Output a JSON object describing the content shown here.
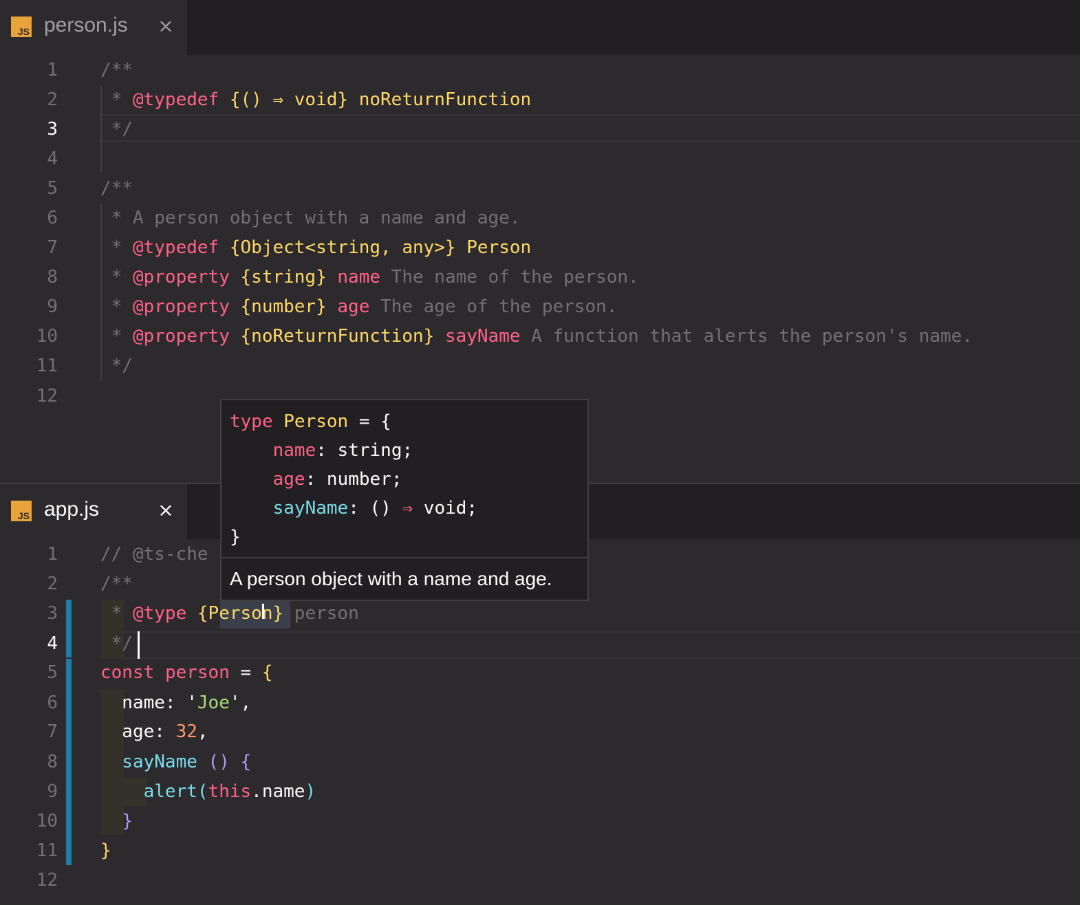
{
  "colors": {
    "background": "#2d2a2e",
    "tabbar": "#221f22",
    "comment": "#727072",
    "keyword": "#ff6188",
    "type": "#ffd866",
    "string": "#a9dc76",
    "number": "#fc9867",
    "function": "#78dce8",
    "bracket_purple": "#ab9df2",
    "modified_gutter": "#1f7ba8"
  },
  "top_editor": {
    "tab": {
      "icon": "JS",
      "label": "person.js",
      "close": "×"
    },
    "current_line": "3",
    "lines": [
      {
        "n": "1",
        "segs": [
          [
            "cm",
            "/**"
          ]
        ]
      },
      {
        "n": "2",
        "segs": [
          [
            "cm",
            " * "
          ],
          [
            "k",
            "@typedef"
          ],
          [
            "w",
            " "
          ],
          [
            "y",
            "{() ⇒ void}"
          ],
          [
            "w",
            " "
          ],
          [
            "y",
            "noReturnFunction"
          ]
        ]
      },
      {
        "n": "3",
        "segs": [
          [
            "cm",
            " */"
          ]
        ]
      },
      {
        "n": "4",
        "segs": []
      },
      {
        "n": "5",
        "segs": [
          [
            "cm",
            "/**"
          ]
        ]
      },
      {
        "n": "6",
        "segs": [
          [
            "cm",
            " * A person object with a name and age."
          ]
        ]
      },
      {
        "n": "7",
        "segs": [
          [
            "cm",
            " * "
          ],
          [
            "k",
            "@typedef"
          ],
          [
            "w",
            " "
          ],
          [
            "y",
            "{Object<string, any>}"
          ],
          [
            "w",
            " "
          ],
          [
            "y",
            "Person"
          ]
        ]
      },
      {
        "n": "8",
        "segs": [
          [
            "cm",
            " * "
          ],
          [
            "k",
            "@property"
          ],
          [
            "w",
            " "
          ],
          [
            "y",
            "{string}"
          ],
          [
            "w",
            " "
          ],
          [
            "k",
            "name"
          ],
          [
            "cm",
            " The name of the person."
          ]
        ]
      },
      {
        "n": "9",
        "segs": [
          [
            "cm",
            " * "
          ],
          [
            "k",
            "@property"
          ],
          [
            "w",
            " "
          ],
          [
            "y",
            "{number}"
          ],
          [
            "w",
            " "
          ],
          [
            "k",
            "age"
          ],
          [
            "cm",
            " The age of the person."
          ]
        ]
      },
      {
        "n": "10",
        "segs": [
          [
            "cm",
            " * "
          ],
          [
            "k",
            "@property"
          ],
          [
            "w",
            " "
          ],
          [
            "y",
            "{noReturnFunction}"
          ],
          [
            "w",
            " "
          ],
          [
            "k",
            "sayName"
          ],
          [
            "cm",
            " A function that alerts the person's name."
          ]
        ]
      },
      {
        "n": "11",
        "segs": [
          [
            "cm",
            " */"
          ]
        ]
      },
      {
        "n": "12",
        "segs": []
      }
    ]
  },
  "bottom_editor": {
    "tab": {
      "icon": "JS",
      "label": "app.js",
      "close": "×"
    },
    "current_line": "4",
    "lines": [
      {
        "n": "1",
        "segs": [
          [
            "cm",
            "// @ts-che"
          ]
        ]
      },
      {
        "n": "2",
        "segs": [
          [
            "cm",
            "/**"
          ]
        ]
      },
      {
        "n": "3",
        "segs": [
          [
            "cm",
            " * "
          ],
          [
            "k",
            "@type"
          ],
          [
            "w",
            " "
          ],
          [
            "y",
            "{Person}"
          ],
          [
            "w",
            " "
          ],
          [
            "cm",
            "person"
          ]
        ]
      },
      {
        "n": "4",
        "segs": [
          [
            "cm",
            " */"
          ]
        ]
      },
      {
        "n": "5",
        "segs": [
          [
            "k",
            "const"
          ],
          [
            "w",
            " "
          ],
          [
            "k",
            "person"
          ],
          [
            "w",
            " = "
          ],
          [
            "y",
            "{"
          ]
        ]
      },
      {
        "n": "6",
        "segs": [
          [
            "w",
            "  name: "
          ],
          [
            "w",
            "'"
          ],
          [
            "g",
            "Joe"
          ],
          [
            "w",
            "',"
          ]
        ]
      },
      {
        "n": "7",
        "segs": [
          [
            "w",
            "  age: "
          ],
          [
            "o",
            "32"
          ],
          [
            "w",
            ","
          ]
        ]
      },
      {
        "n": "8",
        "segs": [
          [
            "c",
            "  sayName"
          ],
          [
            "w",
            " "
          ],
          [
            "p",
            "()"
          ],
          [
            "w",
            " "
          ],
          [
            "p",
            "{"
          ]
        ]
      },
      {
        "n": "9",
        "segs": [
          [
            "c",
            "    alert"
          ],
          [
            "c",
            "("
          ],
          [
            "k",
            "this"
          ],
          [
            "w",
            ".name"
          ],
          [
            "c",
            ")"
          ]
        ]
      },
      {
        "n": "10",
        "segs": [
          [
            "p",
            "  }"
          ]
        ]
      },
      {
        "n": "11",
        "segs": [
          [
            "y",
            "}"
          ]
        ]
      },
      {
        "n": "12",
        "segs": []
      }
    ]
  },
  "hover": {
    "code_lines": [
      {
        "segs": [
          [
            "k",
            "type"
          ],
          [
            "w",
            " "
          ],
          [
            "y",
            "Person"
          ],
          [
            "w",
            " = {"
          ]
        ]
      },
      {
        "segs": [
          [
            "w",
            "    "
          ],
          [
            "k",
            "name"
          ],
          [
            "w",
            ": string;"
          ]
        ]
      },
      {
        "segs": [
          [
            "w",
            "    "
          ],
          [
            "k",
            "age"
          ],
          [
            "w",
            ": number;"
          ]
        ]
      },
      {
        "segs": [
          [
            "w",
            "    "
          ],
          [
            "c",
            "sayName"
          ],
          [
            "w",
            ": () "
          ],
          [
            "k",
            "⇒"
          ],
          [
            "w",
            " void;"
          ]
        ]
      },
      {
        "segs": [
          [
            "w",
            "}"
          ]
        ]
      }
    ],
    "doc": "A person object with a name and age."
  }
}
